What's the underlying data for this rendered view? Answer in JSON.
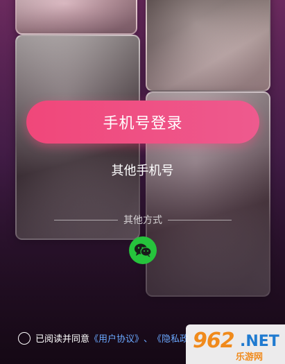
{
  "buttons": {
    "phone_login": "手机号登录",
    "other_phone": "其他手机号"
  },
  "divider": {
    "label": "其他方式"
  },
  "agreement": {
    "prefix": "已阅读并同意",
    "user_agreement": "《用户协议》",
    "separator": "、",
    "privacy_partial": "《隐私政"
  },
  "icons": {
    "wechat": "wechat-icon",
    "radio": "radio-unchecked-icon"
  },
  "colors": {
    "accent": "#f0477a",
    "wechat": "#26c33c",
    "link": "#6aa8ff"
  },
  "watermark": {
    "logo": "962",
    "suffix": ".NET",
    "subtitle": "乐游网"
  }
}
